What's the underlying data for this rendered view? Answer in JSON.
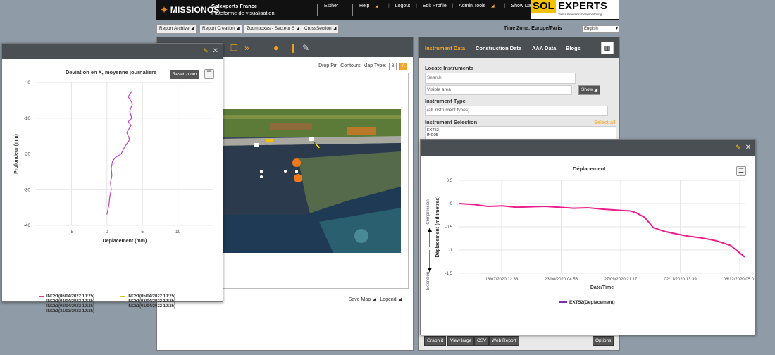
{
  "header": {
    "logo": "MISSIONOS",
    "org_name": "Solexperts France",
    "org_sub": "Plateforme de visualisation",
    "user": "Esther",
    "links": [
      "Help",
      "Logout",
      "Edit Profile",
      "Admin Tools",
      "Show Dashboard"
    ],
    "partner_logo_a": "SOL",
    "partner_logo_b": "EXPERTS",
    "partner_tagline": "Swiss Precision Geomonitoring"
  },
  "toolbar": {
    "buttons": [
      "Report Archive",
      "Report Creation",
      "Zoomboxes - Secteur S",
      "CrossSection"
    ],
    "timezone": "Time Zone: Europe/Paris",
    "language": "English"
  },
  "map": {
    "controls": [
      "Drop Pin",
      "Contours",
      "Map Type:",
      "B",
      "A"
    ],
    "save_map": "Save Map",
    "legend": "Legend"
  },
  "right_panel": {
    "tabs": [
      "Instrument Data",
      "Construction Data",
      "AAA Data",
      "Blogs"
    ],
    "locate_label": "Locate Instruments",
    "search_placeholder": "Search",
    "area_value": "Visible area",
    "show_button": "Show",
    "type_label": "Instrument Type",
    "type_value": "(all instrument types)",
    "selection_label": "Instrument Selection",
    "select_all": "Select all",
    "selection_items": [
      "EXT53",
      "INC05"
    ],
    "bottom_buttons": [
      "Graph it",
      "View large",
      "CSV",
      "Web Report",
      "Options"
    ]
  },
  "profile_chart": {
    "reset_zoom": "Reset zoom",
    "chart_data": {
      "type": "line",
      "title": "Deviation en X, moyenne journaliere",
      "xlabel": "Déplacement (mm)",
      "ylabel": "Profondeur (mm)",
      "xlim": [
        -10,
        15
      ],
      "ylim": [
        -40,
        0
      ],
      "x_ticks": [
        -5,
        0,
        5,
        10
      ],
      "y_ticks": [
        0,
        -10,
        -20,
        -30,
        -40
      ],
      "grid": true,
      "legend_position": "bottom",
      "series": [
        {
          "name": "INC51(06/04/2022 10:25)",
          "color": "#e0407a"
        },
        {
          "name": "INC51(05/04/2022 10:25)",
          "color": "#d4c232"
        },
        {
          "name": "INC51(04/04/2022 10:25)",
          "color": "#2a7fd4"
        },
        {
          "name": "INC51(03/04/2022 10:25)",
          "color": "#e09030"
        },
        {
          "name": "INC51(02/04/2022 10:25)",
          "color": "#7a4fb0"
        },
        {
          "name": "INC51(01/04/2022 10:25)",
          "color": "#80d8e0"
        },
        {
          "name": "INC51(31/03/2022 10:25)",
          "color": "#c040c8",
          "x": [
            3.5,
            3.0,
            3.6,
            3.2,
            3.5,
            3.0,
            3.4,
            3.1,
            2.8,
            3.2,
            2.5,
            2.0,
            1.2,
            0.8,
            0.6,
            0.7,
            0.5,
            0.6,
            0.4,
            0.3,
            0.2,
            0.1,
            0.0
          ],
          "y": [
            -2.5,
            -4,
            -6,
            -8,
            -10,
            -11,
            -12,
            -13,
            -14,
            -16,
            -18,
            -20,
            -21,
            -22,
            -24,
            -26,
            -28,
            -30,
            -32,
            -34,
            -35,
            -36,
            -37
          ]
        }
      ]
    }
  },
  "disp_chart": {
    "zone_top": "Compression",
    "zone_bottom": "Extension",
    "chart_data": {
      "type": "line",
      "title": "Déplacement",
      "xlabel": "Date/Time",
      "ylabel": "Déplacement (millimètres)",
      "ylim": [
        -1.5,
        0.5
      ],
      "y_ticks": [
        0.5,
        0,
        -0.5,
        -1,
        -1.5
      ],
      "x_ticks": [
        "18/07/2020 12:33",
        "23/08/2020 04:55",
        "27/09/2020 21:17",
        "02/11/2020 13:39",
        "08/12/2020 05:01"
      ],
      "grid": true,
      "legend_position": "bottom",
      "series": [
        {
          "name": "EXT52(Deplacement)",
          "color": "#ec1c8c",
          "x": [
            0,
            0.05,
            0.1,
            0.15,
            0.2,
            0.25,
            0.3,
            0.35,
            0.4,
            0.45,
            0.5,
            0.55,
            0.6,
            0.62,
            0.65,
            0.68,
            0.7,
            0.72,
            0.75,
            0.8,
            0.85,
            0.9,
            0.95,
            1.0
          ],
          "y": [
            0,
            -0.02,
            -0.06,
            -0.05,
            -0.08,
            -0.07,
            -0.06,
            -0.08,
            -0.1,
            -0.09,
            -0.12,
            -0.14,
            -0.16,
            -0.2,
            -0.3,
            -0.52,
            -0.56,
            -0.6,
            -0.64,
            -0.7,
            -0.74,
            -0.8,
            -0.9,
            -1.15
          ]
        }
      ]
    }
  }
}
